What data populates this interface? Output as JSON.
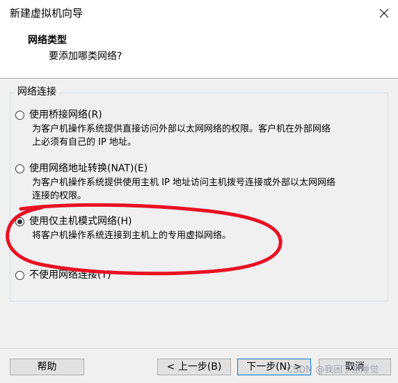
{
  "window": {
    "title": "新建虚拟机向导"
  },
  "header": {
    "title": "网络类型",
    "subtitle": "要添加哪类网络?"
  },
  "network_group": {
    "label": "网络连接",
    "options": [
      {
        "label": "使用桥接网络(R)",
        "description_lines": [
          "为客户机操作系统提供直接访问外部以太网网络的权限。客户机在外部网络",
          "上必须有自己的 IP 地址。"
        ],
        "checked": false
      },
      {
        "label": "使用网络地址转换(NAT)(E)",
        "description_lines": [
          "为客户机操作系统提供使用主机 IP 地址访问主机拨号连接或外部以太网网络",
          "连接的权限。"
        ],
        "checked": false
      },
      {
        "label": "使用仅主机模式网络(H)",
        "description_lines": [
          "将客户机操作系统连接到主机上的专用虚拟网络。"
        ],
        "checked": true
      },
      {
        "label": "不使用网络连接(T)",
        "description_lines": [],
        "checked": false
      }
    ]
  },
  "buttons": {
    "help": "帮助",
    "back": "< 上一步(B)",
    "next": "下一步(N) >",
    "cancel": "取消"
  },
  "watermark": "CSDN @我困了想睡觉",
  "colors": {
    "annotation_stroke": "#e81123",
    "default_button_border": "#0078d7",
    "body_background": "#f0f0f0"
  }
}
